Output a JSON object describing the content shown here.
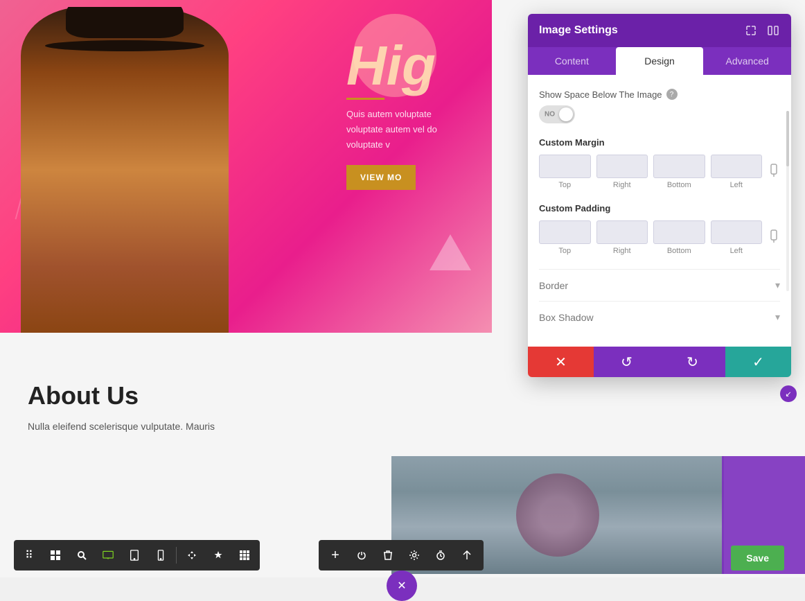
{
  "canvas": {
    "hero": {
      "title": "Hig",
      "subtitle_text": "Quis autem voluptate voluptate autem vel do voluptate v",
      "button_label": "VIEW MO"
    },
    "about": {
      "title": "About Us",
      "body_text": "Nulla eleifend scelerisque vulputate. Mauris"
    }
  },
  "settings_panel": {
    "title": "Image Settings",
    "tabs": [
      {
        "id": "content",
        "label": "Content"
      },
      {
        "id": "design",
        "label": "Design"
      },
      {
        "id": "advanced",
        "label": "Advanced"
      }
    ],
    "active_tab": "design",
    "show_space_label": "Show Space Below The Image",
    "show_space_toggle": "NO",
    "custom_margin_label": "Custom Margin",
    "margin_inputs": [
      {
        "label": "Top",
        "value": ""
      },
      {
        "label": "Right",
        "value": ""
      },
      {
        "label": "Bottom",
        "value": ""
      },
      {
        "label": "Left",
        "value": ""
      }
    ],
    "custom_padding_label": "Custom Padding",
    "padding_inputs": [
      {
        "label": "Top",
        "value": ""
      },
      {
        "label": "Right",
        "value": ""
      },
      {
        "label": "Bottom",
        "value": ""
      },
      {
        "label": "Left",
        "value": ""
      }
    ],
    "border_label": "Border",
    "box_shadow_label": "Box Shadow",
    "footer_buttons": [
      {
        "id": "close",
        "icon": "✕",
        "color": "red"
      },
      {
        "id": "undo",
        "icon": "↺",
        "color": "purple"
      },
      {
        "id": "redo",
        "icon": "↻",
        "color": "purple"
      },
      {
        "id": "confirm",
        "icon": "✓",
        "color": "green"
      }
    ]
  },
  "toolbar_left": {
    "buttons": [
      {
        "id": "grid",
        "icon": "⊞",
        "active": false
      },
      {
        "id": "layout",
        "icon": "⊟",
        "active": false
      },
      {
        "id": "search",
        "icon": "⌕",
        "active": false
      },
      {
        "id": "desktop",
        "icon": "🖥",
        "active": true
      },
      {
        "id": "tablet",
        "icon": "⬜",
        "active": false
      },
      {
        "id": "mobile",
        "icon": "📱",
        "active": false
      },
      {
        "id": "responsive1",
        "icon": "⊞",
        "active": false
      },
      {
        "id": "responsive2",
        "icon": "⊡",
        "active": false
      },
      {
        "id": "grid2",
        "icon": "⊞",
        "active": false
      }
    ]
  },
  "toolbar_center": {
    "buttons": [
      {
        "id": "add",
        "icon": "+"
      },
      {
        "id": "power",
        "icon": "⏻"
      },
      {
        "id": "delete",
        "icon": "🗑"
      },
      {
        "id": "settings",
        "icon": "⚙"
      },
      {
        "id": "timer",
        "icon": "⏱"
      },
      {
        "id": "more",
        "icon": "⇅"
      }
    ]
  },
  "save_button": {
    "label": "Save"
  },
  "close_btn": {
    "icon": "✕"
  }
}
